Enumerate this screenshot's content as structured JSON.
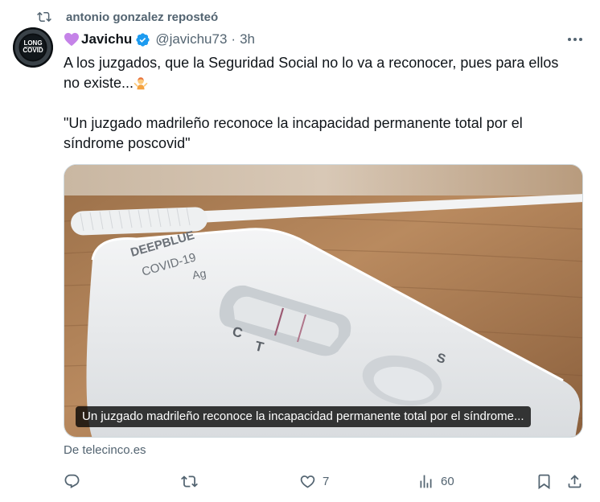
{
  "repost": {
    "icon": "repost-icon",
    "text": "antonio gonzalez reposteó"
  },
  "tweet": {
    "avatar": {
      "lines": [
        "LONG",
        "COVID"
      ],
      "ring_text": "LONG COVID AWARENESS"
    },
    "author": {
      "emoji": "purple-heart-icon",
      "display_name": "Javichu",
      "verified": true,
      "handle": "@javichu73",
      "separator": "·",
      "time": "3h"
    },
    "text": {
      "paragraph1": "A los juzgados, que la Seguridad Social no lo va a reconocer, pues para ellos no existe...",
      "paragraph1_emoji": "person-shrugging-emoji",
      "paragraph2": "\"Un juzgado madrileño reconoce la incapacidad permanente total por el síndrome poscovid\""
    },
    "card": {
      "image_caption": "Un juzgado madrileño reconoce la incapacidad permanente total por el síndrome...",
      "image_text": {
        "brand": "DEEPBLUE",
        "product": "COVID-19",
        "type": "Ag",
        "c": "C",
        "t": "T",
        "s": "S"
      },
      "source": "De telecinco.es"
    },
    "actions": {
      "reply": {
        "icon": "reply-icon",
        "count": ""
      },
      "repost": {
        "icon": "repost-icon",
        "count": ""
      },
      "like": {
        "icon": "heart-icon",
        "count": "7"
      },
      "views": {
        "icon": "views-icon",
        "count": "60"
      },
      "bookmark": {
        "icon": "bookmark-icon"
      },
      "share": {
        "icon": "share-icon"
      }
    }
  },
  "colors": {
    "text": "#0f1419",
    "secondary": "#536471",
    "verified": "#1d9bf0",
    "heart": "#c583e8"
  }
}
